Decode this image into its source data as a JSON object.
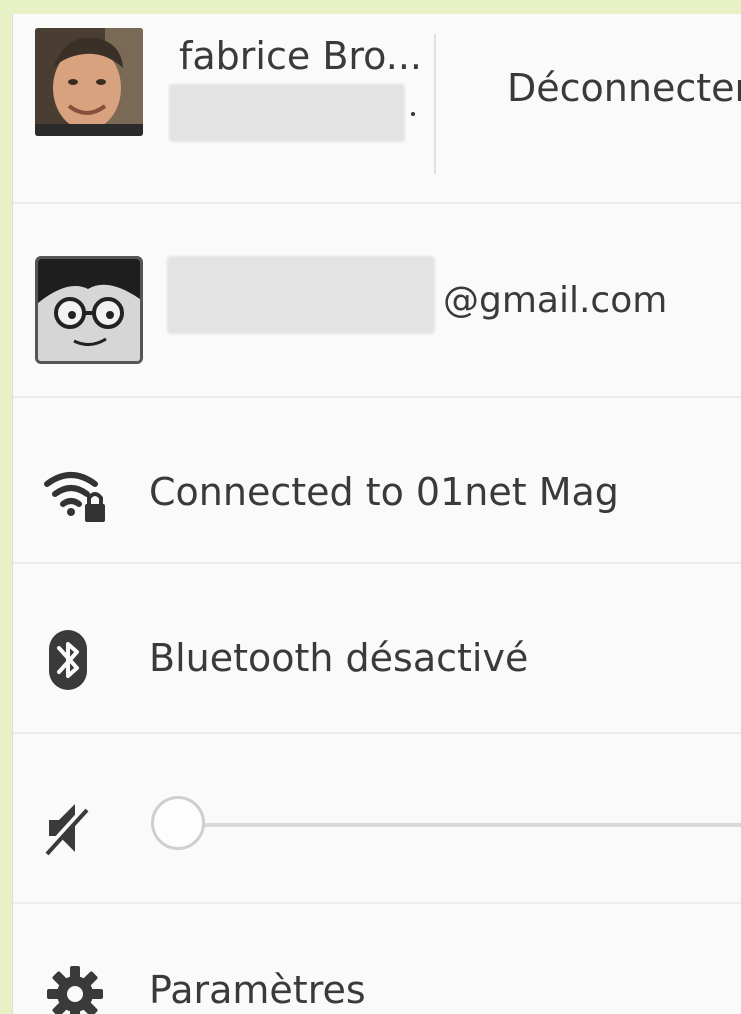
{
  "account": {
    "display_name": "fabrice Bro...",
    "logout_label": "Déconnecter"
  },
  "secondary_account": {
    "email_suffix": "@gmail.com"
  },
  "network": {
    "status_label": "Connected to 01net Mag",
    "icon": "wifi-lock-icon"
  },
  "bluetooth": {
    "status_label": "Bluetooth désactivé",
    "icon": "bluetooth-icon"
  },
  "volume": {
    "icon": "volume-muted-icon",
    "level": 0
  },
  "settings": {
    "label": "Paramètres",
    "icon": "gear-icon"
  },
  "colors": {
    "panel_bg": "#fafafa",
    "page_bg": "#e8f0c6",
    "text": "#3a3a3a",
    "divider": "#ececec"
  }
}
